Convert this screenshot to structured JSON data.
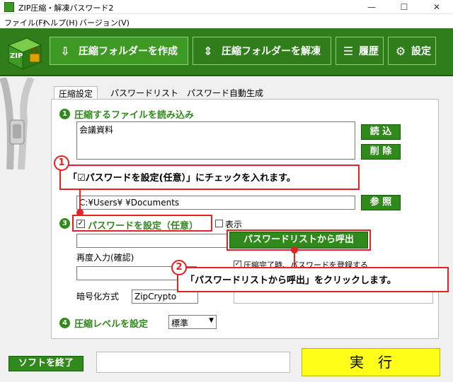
{
  "window": {
    "title": "ZIP圧縮・解凍パスワード2",
    "minimize": "—",
    "maximize": "☐",
    "close": "✕"
  },
  "menu": [
    "ファイル(F)",
    "ヘルプ(H)",
    "バージョン(V)"
  ],
  "toolbar": {
    "create_label": "圧縮フォルダーを作成",
    "extract_label": "圧縮フォルダーを解凍",
    "history_label": "履歴",
    "settings_label": "設定",
    "logo_text": "ZIP"
  },
  "tabs": [
    "圧縮設定",
    "パスワードリスト",
    "パスワード自動生成"
  ],
  "section1": {
    "num": "1",
    "title": "圧縮するファイルを読み込み",
    "file_item": "会議資料",
    "load_label": "読 込",
    "delete_label": "削 除"
  },
  "path": {
    "value": "C:¥Users¥       ¥Documents",
    "browse_label": "参 照"
  },
  "section3": {
    "num": "3",
    "checkbox_checked": true,
    "title": "パスワードを設定（任意）",
    "show_label": "表示",
    "call_list_label": "パスワードリストから呼出",
    "reenter_label": "再度入力(確認)",
    "register_label": "圧縮完了時、パスワードを登録する",
    "encrypt_label": "暗号化方式",
    "encrypt_value": "ZipCrypto"
  },
  "section4": {
    "num": "4",
    "title": "圧縮レベルを設定",
    "level_value": "標準"
  },
  "callouts": {
    "c1_num": "1",
    "c1_text": "「☑パスワードを設定(任意）」にチェックを入れます。",
    "c2_num": "2",
    "c2_text": "「パスワードリストから呼出」をクリックします。"
  },
  "bottom": {
    "exit_label": "ソフトを終了",
    "run_label": "実　行"
  },
  "colors": {
    "accent_green": "#2f7d1b",
    "annotation_red": "#e52121",
    "run_yellow": "#ffff19"
  }
}
